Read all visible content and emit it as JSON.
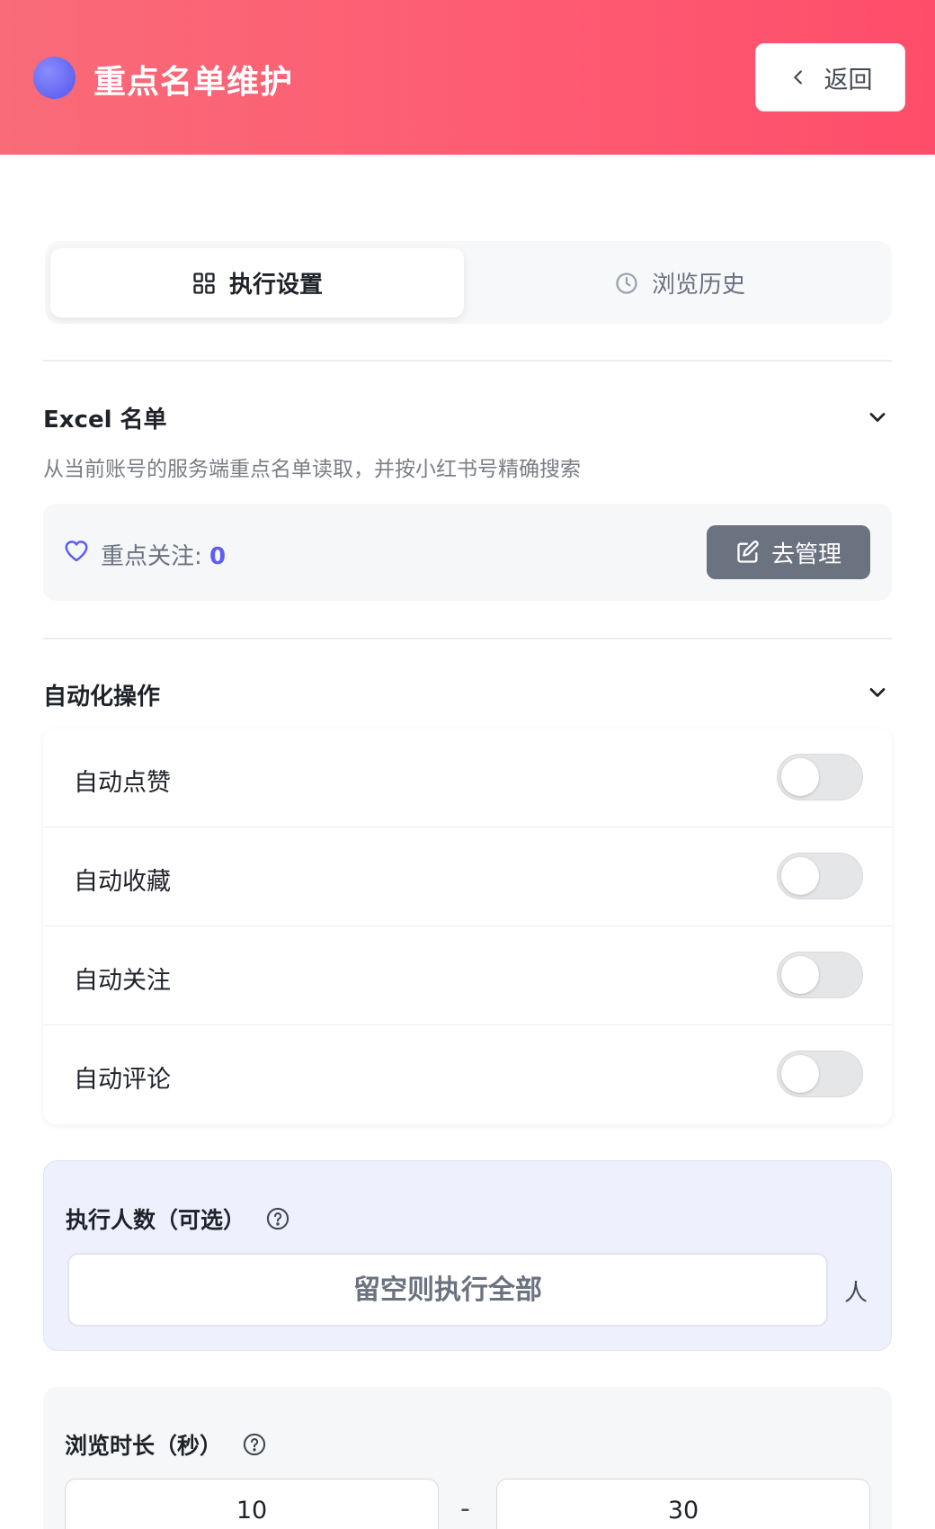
{
  "header": {
    "title": "重点名单维护",
    "back_label": "返回",
    "gradient_start": "#f96b78",
    "gradient_end": "#fd4d6a",
    "dot_color": "#6366f1"
  },
  "tabs": [
    {
      "label": "执行设置",
      "icon": "grid-icon",
      "active": true
    },
    {
      "label": "浏览历史",
      "icon": "clock-icon",
      "active": false
    }
  ],
  "excel_section": {
    "title": "Excel 名单",
    "description": "从当前账号的服务端重点名单读取，并按小红书号精确搜索",
    "focus_label": "重点关注: ",
    "focus_count": "0",
    "manage_button": "去管理"
  },
  "automation_section": {
    "title": "自动化操作",
    "toggles": [
      {
        "label": "自动点赞",
        "on": false
      },
      {
        "label": "自动收藏",
        "on": false
      },
      {
        "label": "自动关注",
        "on": false
      },
      {
        "label": "自动评论",
        "on": false
      }
    ]
  },
  "exec_count": {
    "title": "执行人数（可选）",
    "placeholder": "留空则执行全部",
    "unit": "人"
  },
  "browse_duration": {
    "title": "浏览时长（秒）",
    "min_value": "10",
    "max_value": "30",
    "separator": "-"
  },
  "colors": {
    "accent": "#5b5ef0",
    "manage_button_bg": "#6b7280"
  }
}
